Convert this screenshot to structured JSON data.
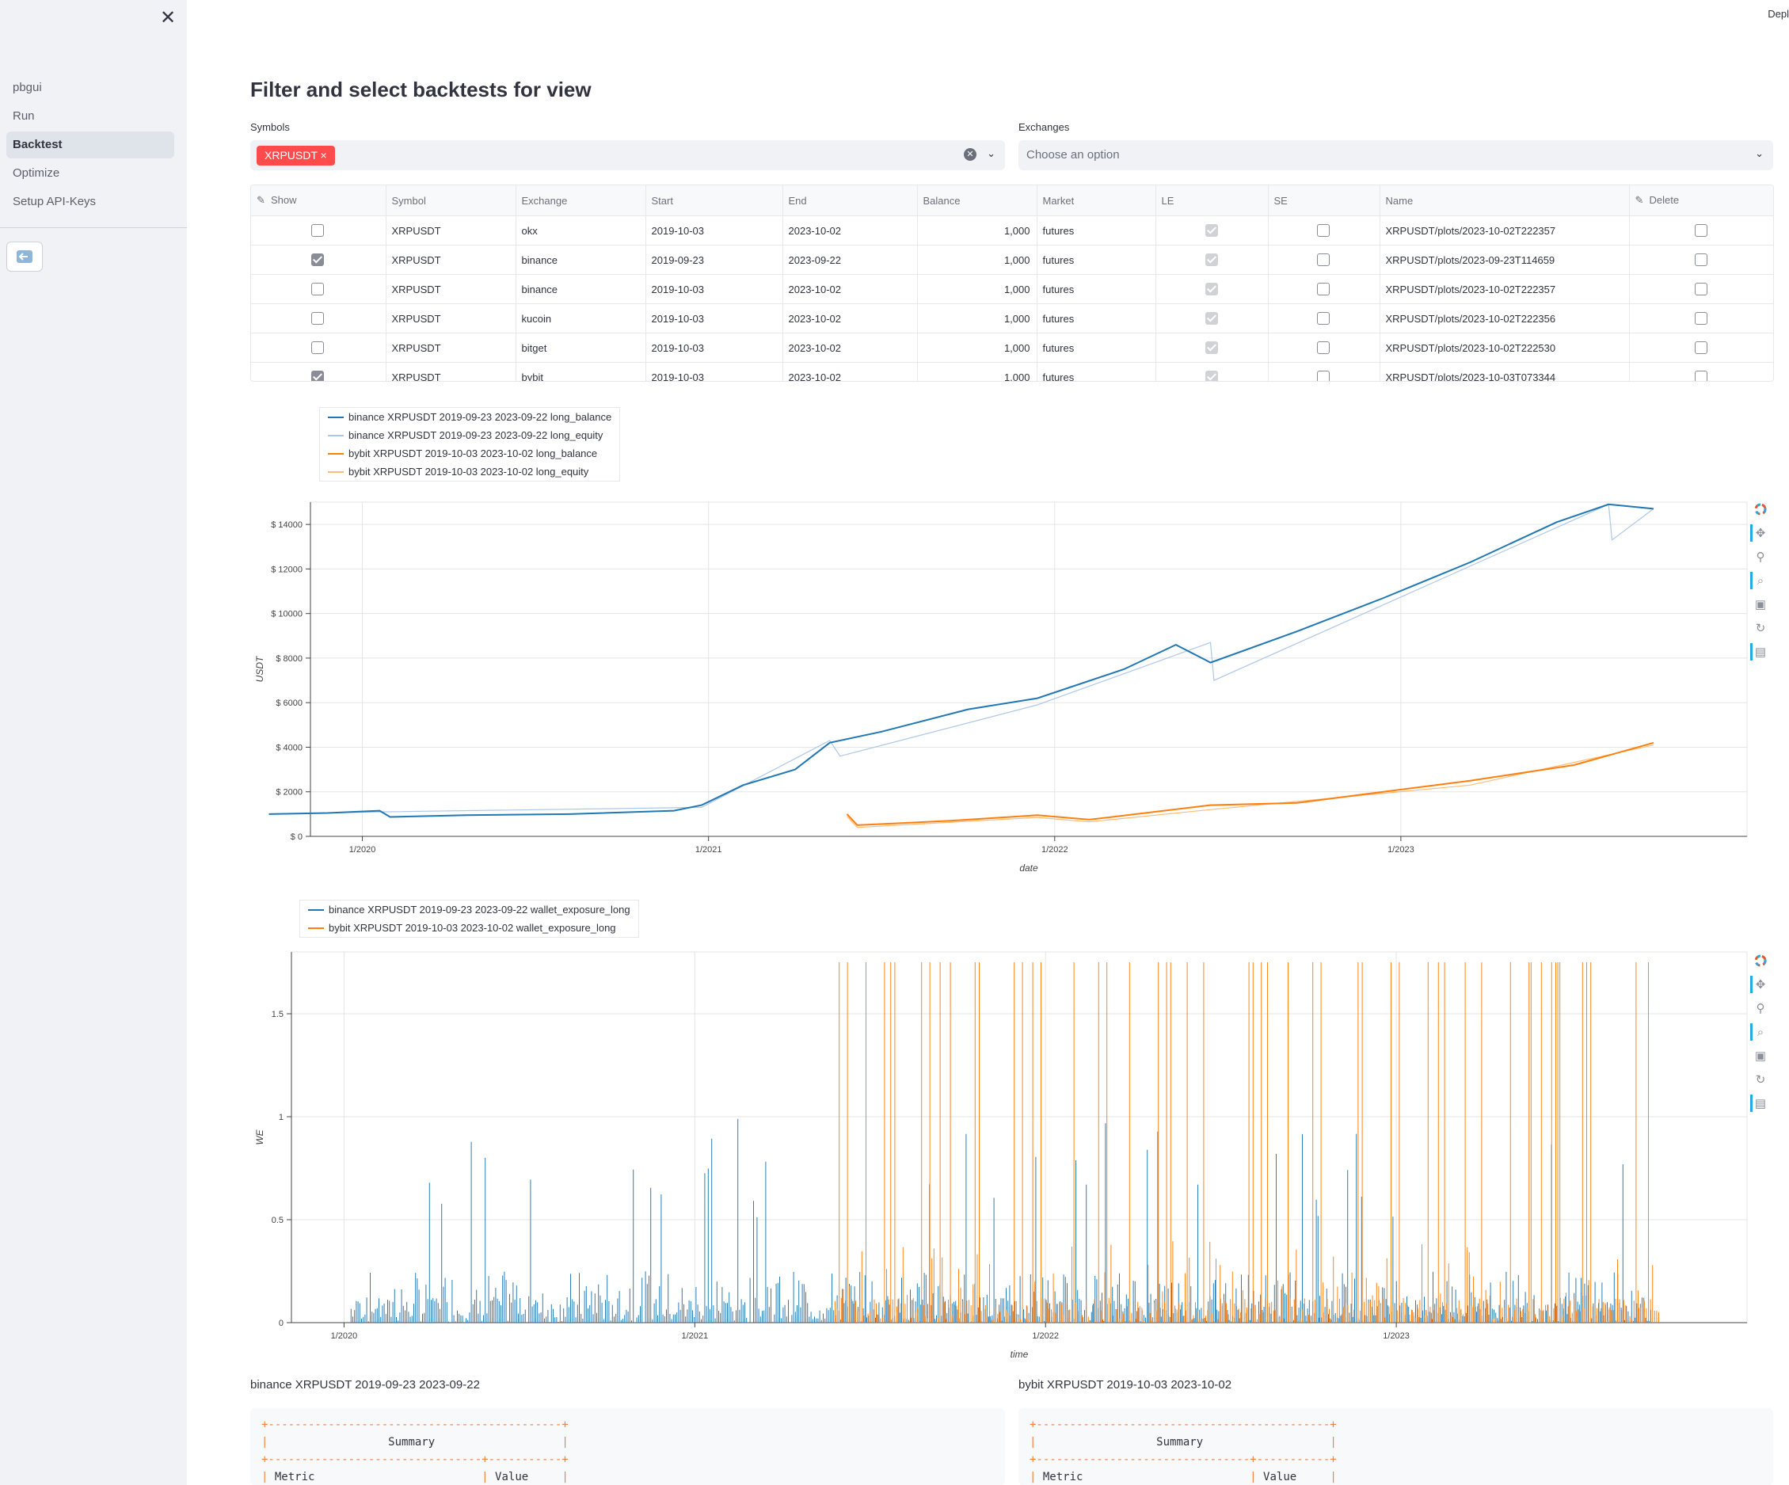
{
  "sidebar": {
    "items": [
      {
        "label": "pbgui",
        "active": false
      },
      {
        "label": "Run",
        "active": false
      },
      {
        "label": "Backtest",
        "active": true
      },
      {
        "label": "Optimize",
        "active": false
      },
      {
        "label": "Setup API-Keys",
        "active": false
      }
    ]
  },
  "header": {
    "deploy_label": "Depl"
  },
  "page_title": "Filter and select backtests for view",
  "filters": {
    "symbols_label": "Symbols",
    "symbols_selected": "XRPUSDT",
    "exchanges_label": "Exchanges",
    "exchanges_placeholder": "Choose an option"
  },
  "table": {
    "columns": [
      "Show",
      "Symbol",
      "Exchange",
      "Start",
      "End",
      "Balance",
      "Market",
      "LE",
      "SE",
      "Name",
      "Delete"
    ],
    "rows": [
      {
        "show": false,
        "symbol": "XRPUSDT",
        "exchange": "okx",
        "start": "2019-10-03",
        "end": "2023-10-02",
        "balance": "1,000",
        "market": "futures",
        "le": true,
        "se": false,
        "name": "XRPUSDT/plots/2023-10-02T222357",
        "delete": false
      },
      {
        "show": true,
        "symbol": "XRPUSDT",
        "exchange": "binance",
        "start": "2019-09-23",
        "end": "2023-09-22",
        "balance": "1,000",
        "market": "futures",
        "le": true,
        "se": false,
        "name": "XRPUSDT/plots/2023-09-23T114659",
        "delete": false
      },
      {
        "show": false,
        "symbol": "XRPUSDT",
        "exchange": "binance",
        "start": "2019-10-03",
        "end": "2023-10-02",
        "balance": "1,000",
        "market": "futures",
        "le": true,
        "se": false,
        "name": "XRPUSDT/plots/2023-10-02T222357",
        "delete": false
      },
      {
        "show": false,
        "symbol": "XRPUSDT",
        "exchange": "kucoin",
        "start": "2019-10-03",
        "end": "2023-10-02",
        "balance": "1,000",
        "market": "futures",
        "le": true,
        "se": false,
        "name": "XRPUSDT/plots/2023-10-02T222356",
        "delete": false
      },
      {
        "show": false,
        "symbol": "XRPUSDT",
        "exchange": "bitget",
        "start": "2019-10-03",
        "end": "2023-10-02",
        "balance": "1,000",
        "market": "futures",
        "le": true,
        "se": false,
        "name": "XRPUSDT/plots/2023-10-02T222530",
        "delete": false
      },
      {
        "show": true,
        "symbol": "XRPUSDT",
        "exchange": "bybit",
        "start": "2019-10-03",
        "end": "2023-10-02",
        "balance": "1,000",
        "market": "futures",
        "le": true,
        "se": false,
        "name": "XRPUSDT/plots/2023-10-03T073344",
        "delete": false
      }
    ]
  },
  "colors": {
    "blue": "#1f77b4",
    "blue_light": "#aec7e8",
    "orange": "#ff7f0e",
    "orange_light": "#ffbb78",
    "red_tag": "#ff4b4b"
  },
  "chart_data": [
    {
      "type": "line",
      "xlabel": "date",
      "ylabel": "USDT",
      "ylim": [
        0,
        15000
      ],
      "yticks": [
        "$ 0",
        "$ 2000",
        "$ 4000",
        "$ 6000",
        "$ 8000",
        "$ 10000",
        "$ 12000",
        "$ 14000"
      ],
      "ytick_values": [
        0,
        2000,
        4000,
        6000,
        8000,
        10000,
        12000,
        14000
      ],
      "xticks": [
        "1/2020",
        "1/2021",
        "1/2022",
        "1/2023"
      ],
      "xtick_values": [
        2020.0,
        2021.0,
        2022.0,
        2023.0
      ],
      "xlim": [
        2019.85,
        2024.0
      ],
      "legend_position": "top-left",
      "series": [
        {
          "name": "binance XRPUSDT 2019-09-23 2023-09-22 long_balance",
          "color": "#1f77b4",
          "x": [
            2019.73,
            2019.9,
            2020.05,
            2020.08,
            2020.3,
            2020.6,
            2020.9,
            2020.98,
            2021.1,
            2021.25,
            2021.35,
            2021.5,
            2021.75,
            2021.95,
            2022.2,
            2022.35,
            2022.45,
            2022.7,
            2022.95,
            2023.2,
            2023.45,
            2023.6,
            2023.73
          ],
          "y": [
            1000,
            1050,
            1150,
            870,
            950,
            1000,
            1150,
            1400,
            2300,
            3000,
            4200,
            4700,
            5700,
            6200,
            7500,
            8600,
            7800,
            9200,
            10700,
            12300,
            14100,
            14900,
            14700
          ]
        },
        {
          "name": "binance XRPUSDT 2019-09-23 2023-09-22 long_equity",
          "color": "#aec7e8",
          "x": [
            2019.73,
            2020.05,
            2020.98,
            2021.35,
            2021.38,
            2021.95,
            2022.45,
            2022.46,
            2023.6,
            2023.61,
            2023.73
          ],
          "y": [
            1000,
            1100,
            1300,
            4300,
            3600,
            5900,
            8700,
            7000,
            14900,
            13300,
            14700
          ]
        },
        {
          "name": "bybit XRPUSDT 2019-10-03 2023-10-02 long_balance",
          "color": "#ff7f0e",
          "x": [
            2021.4,
            2021.43,
            2021.7,
            2021.95,
            2022.1,
            2022.45,
            2022.7,
            2022.9,
            2023.2,
            2023.5,
            2023.73
          ],
          "y": [
            1000,
            500,
            700,
            950,
            750,
            1400,
            1500,
            1900,
            2500,
            3200,
            4200
          ]
        },
        {
          "name": "bybit XRPUSDT 2019-10-03 2023-10-02 long_equity",
          "color": "#ffbb78",
          "x": [
            2021.4,
            2021.43,
            2021.95,
            2022.1,
            2022.45,
            2023.2,
            2023.73
          ],
          "y": [
            900,
            400,
            850,
            650,
            1200,
            2300,
            4100
          ]
        }
      ]
    },
    {
      "type": "line",
      "xlabel": "time",
      "ylabel": "WE",
      "ylim": [
        0,
        1.8
      ],
      "yticks": [
        "0",
        "0.5",
        "1",
        "1.5"
      ],
      "ytick_values": [
        0,
        0.5,
        1,
        1.5
      ],
      "xticks": [
        "1/2020",
        "1/2021",
        "1/2022",
        "1/2023"
      ],
      "xtick_values": [
        2020.0,
        2021.0,
        2022.0,
        2023.0
      ],
      "xlim": [
        2019.85,
        2024.0
      ],
      "legend_position": "top-left",
      "series": [
        {
          "name": "binance XRPUSDT 2019-09-23 2023-09-22 wallet_exposure_long",
          "color": "#1f77b4",
          "range": [
            2020.02,
            2023.73
          ],
          "max": 1.0
        },
        {
          "name": "bybit XRPUSDT 2019-10-03 2023-10-02 wallet_exposure_long",
          "color": "#ff7f0e",
          "range": [
            2021.4,
            2023.75
          ],
          "max": 1.75
        }
      ]
    }
  ],
  "summaries": [
    {
      "title": "binance XRPUSDT 2019-09-23 2023-09-22",
      "header": "Summary",
      "col1": "Metric",
      "col2": "Value"
    },
    {
      "title": "bybit XRPUSDT 2019-10-03 2023-10-02",
      "header": "Summary",
      "col1": "Metric",
      "col2": "Value"
    }
  ]
}
